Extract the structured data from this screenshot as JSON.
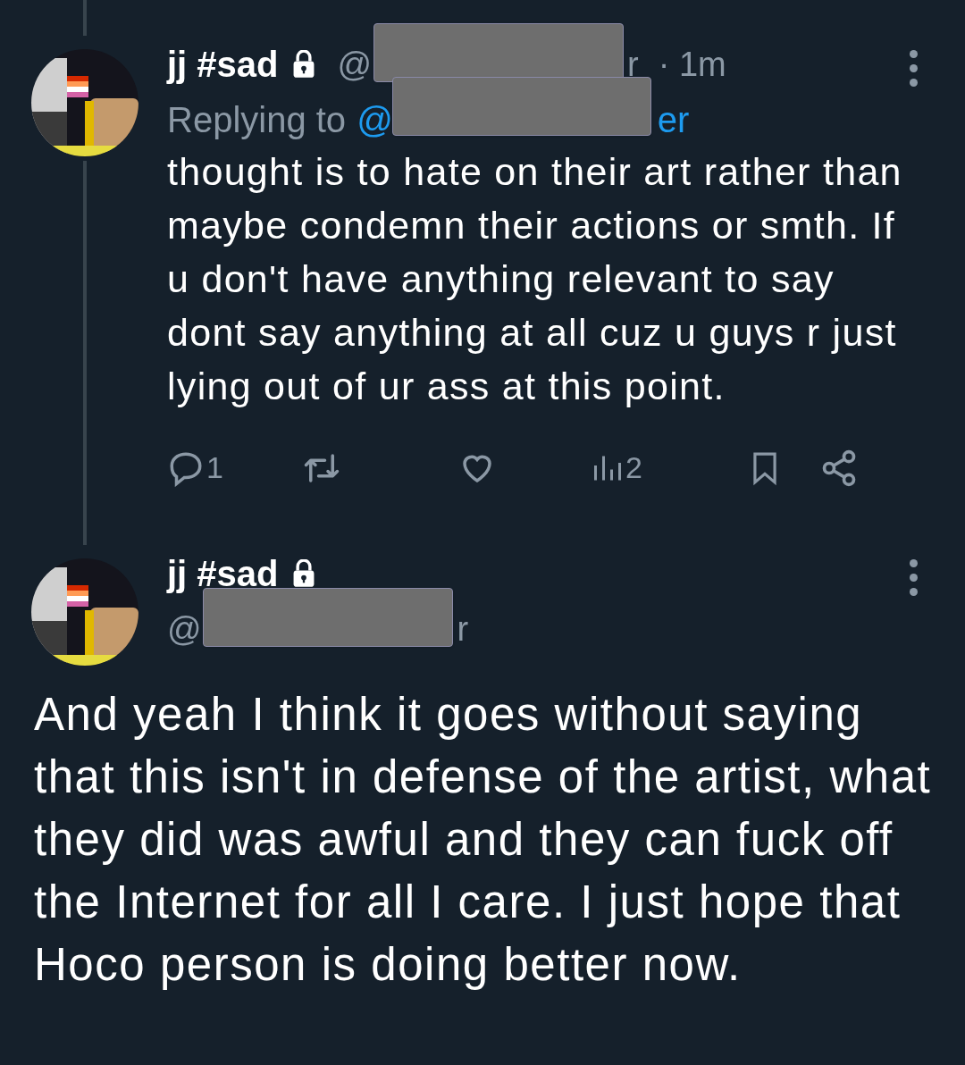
{
  "tweets": [
    {
      "name": "jj #sad",
      "locked": true,
      "handle": {
        "start": "@",
        "end": "r",
        "redacted": true
      },
      "time": "· 1m",
      "reply_to": {
        "label": "Replying to",
        "start": "@",
        "end": "er",
        "redacted": true
      },
      "thread_line": true,
      "text": "thought is to hate on their art rather than maybe condemn their actions or smth. If u don't have anything relevant to say dont say anything at all cuz u guys r just lying out of ur ass at this point.",
      "actions": [
        {
          "kind": "reply",
          "count": "1"
        },
        {
          "kind": "repost"
        },
        {
          "kind": "like"
        },
        {
          "kind": "views",
          "count": "2"
        },
        {
          "kind": "bookmark"
        },
        {
          "kind": "share"
        }
      ]
    },
    {
      "name": "jj #sad",
      "locked": true,
      "handle": {
        "start": "@",
        "end": "r",
        "redacted": true
      },
      "thread_line": false,
      "text": "And yeah I think it goes without saying that this isn't in defense of the artist, what they did was awful and they can fuck off the Internet for all I care. I just hope that Hoco person is doing better now."
    }
  ]
}
